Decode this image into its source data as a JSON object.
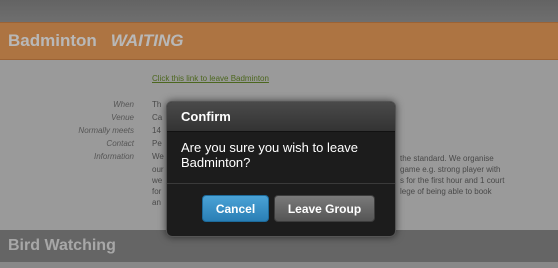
{
  "group": {
    "name": "Badminton",
    "status": "WAITING",
    "leave_link": "Click this link to leave Badminton"
  },
  "details": [
    {
      "label": "When",
      "value": "Th"
    },
    {
      "label": "Venue",
      "value": "Ca"
    },
    {
      "label": "Normally meets",
      "value": "14"
    },
    {
      "label": "Contact",
      "value": "Pe"
    },
    {
      "label": "Information",
      "value": "We"
    }
  ],
  "information_visible": [
    "the standard. We organise",
    "our",
    "game e.g. strong player with",
    "we",
    "s for the first hour and 1 court",
    "for",
    "lege of being able to book",
    "an"
  ],
  "next_group": {
    "name": "Bird Watching"
  },
  "dialog": {
    "title": "Confirm",
    "message": "Are you sure you wish to leave Badminton?",
    "cancel_label": "Cancel",
    "leave_label": "Leave Group"
  },
  "colors": {
    "header_accent": "#f0a15c",
    "cancel_button": "#2a7fb5",
    "leave_button": "#5e5e5e",
    "link": "#6a8f2a"
  }
}
